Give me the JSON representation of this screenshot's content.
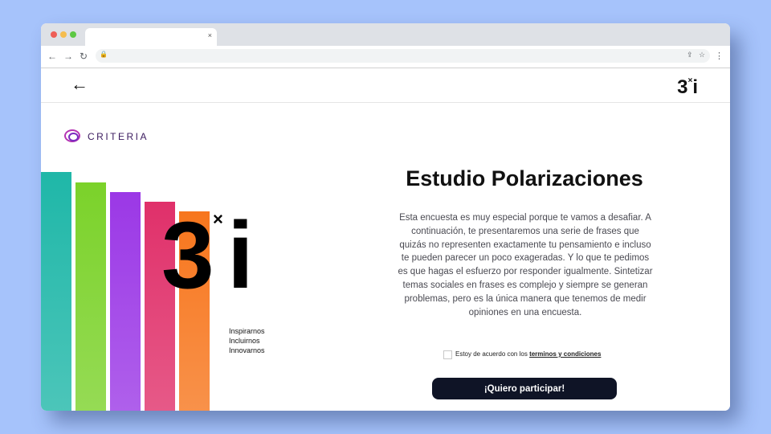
{
  "browser": {
    "tab_title": "",
    "tab_close_icon": "close-icon",
    "url": "",
    "nav": {
      "back": "←",
      "forward": "→",
      "reload": "↻"
    }
  },
  "header": {
    "logo_main": "3",
    "logo_mark": "×",
    "logo_i": "i"
  },
  "brand": {
    "criteria": "CRITERIA",
    "logo_main": "3",
    "logo_mark": "×",
    "logo_i": "i",
    "tagline": [
      "Inspirarnos",
      "Incluirnos",
      "Innovarnos"
    ]
  },
  "bar_colors": [
    "#1fb7a8",
    "#7bd22a",
    "#9b38e6",
    "#e0306a",
    "#f7761d"
  ],
  "main": {
    "title": "Estudio Polarizaciones",
    "description": "Esta encuesta es muy especial porque te vamos a desafiar. A continuación, te presentaremos una serie de frases que quizás no representen exactamente tu pensamiento e incluso te pueden parecer un poco exageradas. Y lo que te pedimos es que hagas el esfuerzo por responder igualmente. Sintetizar temas sociales en frases es complejo y siempre se generan problemas, pero es la única manera que tenemos de medir opiniones en una encuesta.",
    "agree_text": "Estoy de acuerdo con los ",
    "agree_link": "terminos y condiciones",
    "cta": "¡Quiero participar!"
  }
}
